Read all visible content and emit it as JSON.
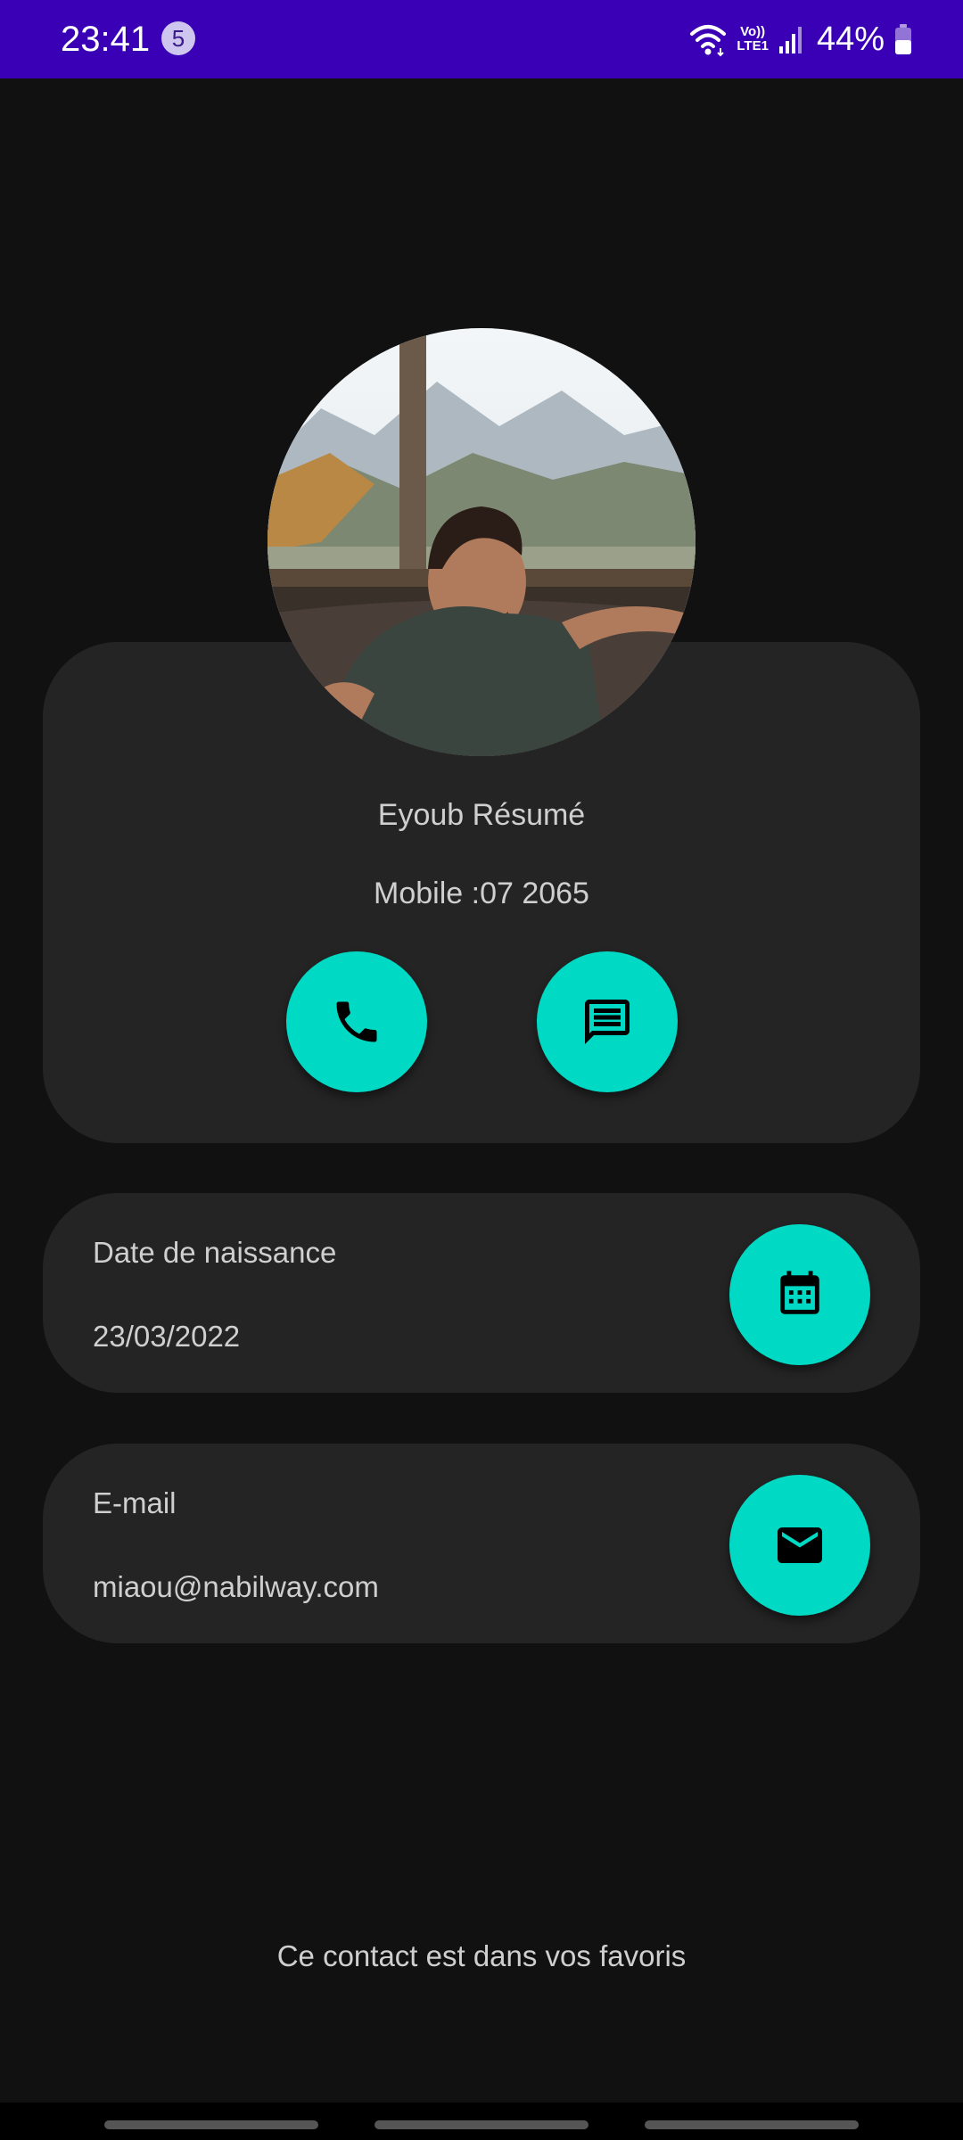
{
  "status_bar": {
    "time": "23:41",
    "notification_count": "5",
    "network_label_top": "Vo))",
    "network_label_bottom": "LTE1",
    "battery_percent": "44%"
  },
  "contact": {
    "name": "Eyoub Résumé",
    "mobile": "Mobile :07  2065 ",
    "icons": {
      "call": "phone-icon",
      "message": "message-icon"
    }
  },
  "birth_card": {
    "label": "Date de naissance",
    "value": "23/03/2022",
    "icon": "calendar-icon"
  },
  "email_card": {
    "label": "E-mail",
    "value": "miaou@nabilway.com",
    "icon": "mail-icon"
  },
  "favorite_note": "Ce contact est dans vos favoris",
  "colors": {
    "status_bar": "#3a00b5",
    "background": "#111111",
    "card": "#242424",
    "accent": "#00d9c4",
    "text": "#cfcfcf"
  }
}
